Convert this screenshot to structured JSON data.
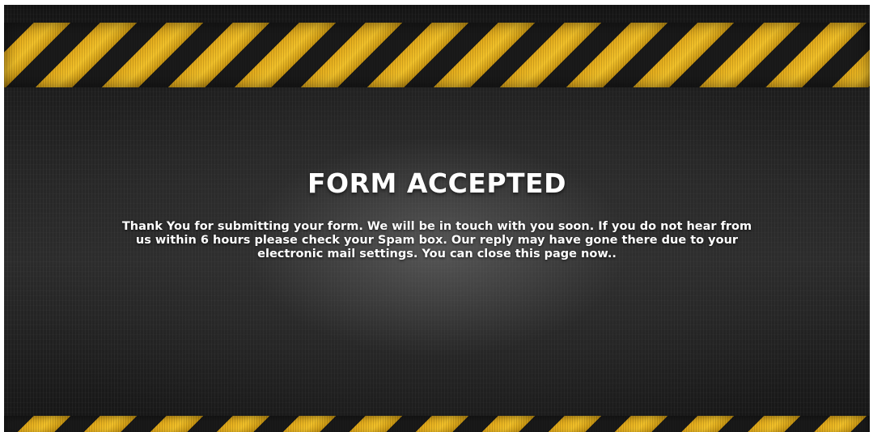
{
  "page": {
    "title": "FORM ACCEPTED",
    "message": "Thank You for submitting your form. We will be in touch with you soon. If you do not hear from us within 6 hours please check your Spam box. Our reply may have gone there due to your electronic mail settings. You can close this page now.."
  },
  "colors": {
    "stripe_yellow": "#f2c12a",
    "stripe_dark": "#1a1a1a",
    "background": "#262626",
    "text": "#ffffff"
  }
}
